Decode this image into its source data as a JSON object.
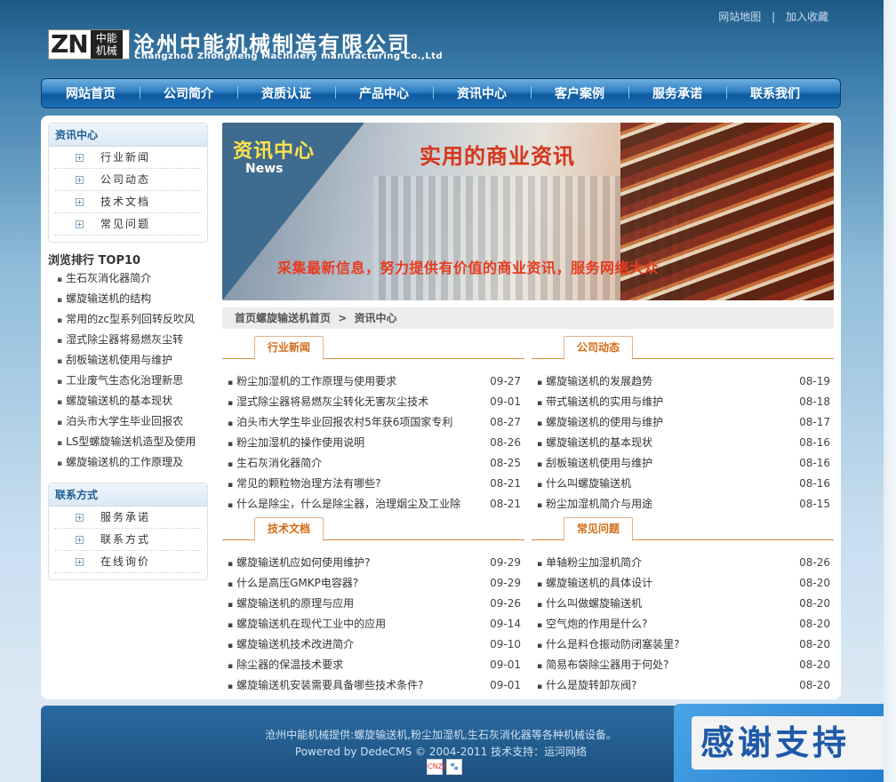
{
  "header": {
    "top_links": [
      "网站地图",
      "|",
      "加入收藏"
    ],
    "logo_letters": "ZN",
    "logo_cn": "中能机械",
    "company_cn": "沧州中能机械制造有限公司",
    "company_en": "Changzhou Zhongneng Machinery manufacturing Co.,Ltd"
  },
  "nav": [
    "网站首页",
    "公司简介",
    "资质认证",
    "产品中心",
    "资讯中心",
    "客户案例",
    "服务承诺",
    "联系我们"
  ],
  "sidebar": {
    "news_title": "资讯中心",
    "news_items": [
      "行业新闻",
      "公司动态",
      "技术文档",
      "常见问题"
    ],
    "rank_title": "浏览排行 TOP10",
    "rank_items": [
      "生石灰消化器简介",
      "螺旋输送机的结构",
      "常用的zc型系列回转反吹风",
      "湿式除尘器将易燃灰尘转",
      "刮板输送机使用与维护",
      "工业废气生态化治理新思",
      "螺旋输送机的基本现状",
      "泊头市大学生毕业回报农",
      "LS型螺旋输送机造型及使用",
      "螺旋输送机的工作原理及"
    ],
    "contact_title": "联系方式",
    "contact_items": [
      "服务承诺",
      "联系方式",
      "在线询价"
    ]
  },
  "banner": {
    "label_cn": "资讯中心",
    "label_en": "News",
    "headline": "实用的商业资讯",
    "slogan": "采集最新信息，努力提供有价值的商业资讯，服务网络大众"
  },
  "breadcrumb": {
    "home": "首页螺旋输送机首页",
    "sep": ">",
    "current": "资讯中心"
  },
  "blocks": {
    "industry": {
      "title": "行业新闻",
      "items": [
        {
          "t": "粉尘加湿机的工作原理与使用要求",
          "d": "09-27"
        },
        {
          "t": "湿式除尘器将易燃灰尘转化无害灰尘技术",
          "d": "09-01"
        },
        {
          "t": "泊头市大学生毕业回报农村5年获6项国家专利",
          "d": "08-27"
        },
        {
          "t": "粉尘加湿机的操作使用说明",
          "d": "08-26"
        },
        {
          "t": "生石灰消化器简介",
          "d": "08-25"
        },
        {
          "t": "常见的颗粒物治理方法有哪些?",
          "d": "08-21"
        },
        {
          "t": "什么是除尘，什么是除尘器，治理烟尘及工业除",
          "d": "08-21"
        }
      ]
    },
    "company": {
      "title": "公司动态",
      "items": [
        {
          "t": "螺旋输送机的发展趋势",
          "d": "08-19"
        },
        {
          "t": "带式输送机的实用与维护",
          "d": "08-18"
        },
        {
          "t": "螺旋输送机的使用与维护",
          "d": "08-17"
        },
        {
          "t": "螺旋输送机的基本现状",
          "d": "08-16"
        },
        {
          "t": "刮板输送机使用与维护",
          "d": "08-16"
        },
        {
          "t": "什么叫螺旋输送机",
          "d": "08-16"
        },
        {
          "t": "粉尘加湿机简介与用途",
          "d": "08-15"
        }
      ]
    },
    "tech": {
      "title": "技术文档",
      "items": [
        {
          "t": "螺旋输送机应如何使用维护?",
          "d": "09-29"
        },
        {
          "t": "什么是高压GMKP电容器?",
          "d": "09-29"
        },
        {
          "t": "螺旋输送机的原理与应用",
          "d": "09-26"
        },
        {
          "t": "螺旋输送机在现代工业中的应用",
          "d": "09-14"
        },
        {
          "t": "螺旋输送机技术改进简介",
          "d": "09-10"
        },
        {
          "t": "除尘器的保温技术要求",
          "d": "09-01"
        },
        {
          "t": "螺旋输送机安装需要具备哪些技术条件?",
          "d": "09-01"
        }
      ]
    },
    "faq": {
      "title": "常见问题",
      "items": [
        {
          "t": "单轴粉尘加湿机简介",
          "d": "08-26"
        },
        {
          "t": "螺旋输送机的具体设计",
          "d": "08-20"
        },
        {
          "t": "什么叫做螺旋输送机",
          "d": "08-20"
        },
        {
          "t": "空气炮的作用是什么?",
          "d": "08-20"
        },
        {
          "t": "什么是料仓振动防闭塞装里?",
          "d": "08-20"
        },
        {
          "t": "简易布袋除尘器用于何处?",
          "d": "08-20"
        },
        {
          "t": "什么是旋转卸灰阀?",
          "d": "08-20"
        }
      ]
    }
  },
  "footer": {
    "line1": "沧州中能机械提供:螺旋输送机,粉尘加湿机,生石灰消化器等各种机械设备。",
    "line2": "Powered by DedeCMS © 2004-2011 技术支持：运河网络",
    "badge1": "CNZZ",
    "badge2": "🐾"
  },
  "float_ad": {
    "text": "感谢支持"
  }
}
